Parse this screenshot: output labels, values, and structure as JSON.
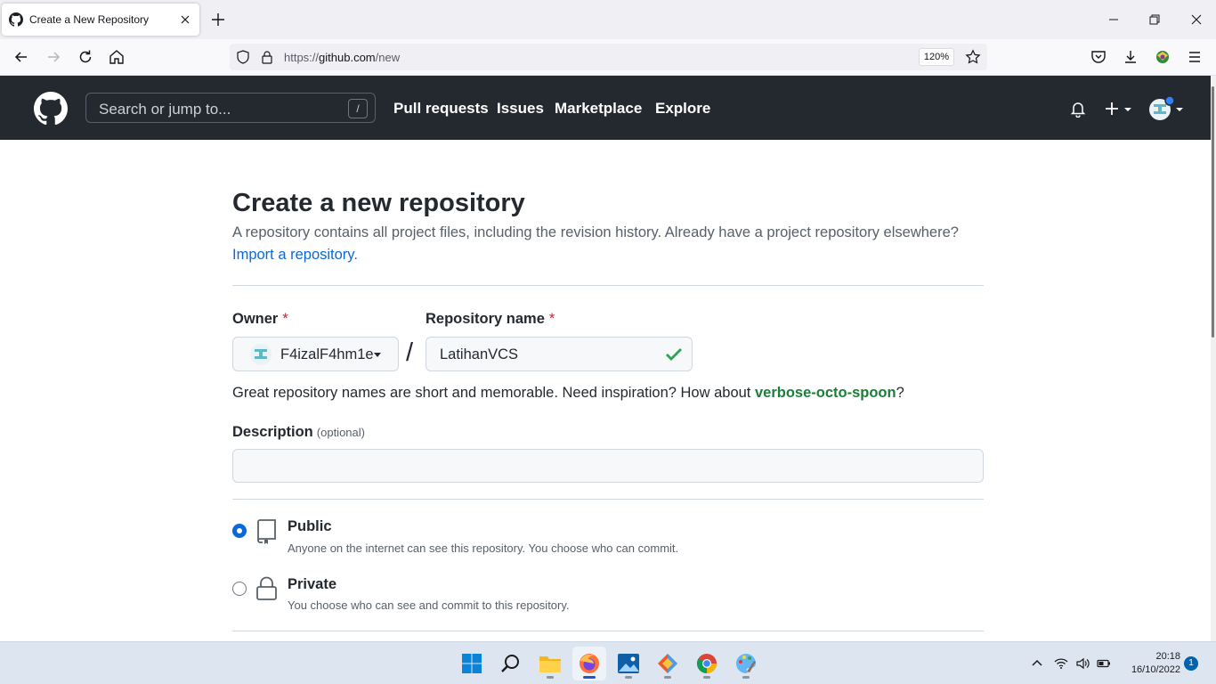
{
  "browser": {
    "tab_title": "Create a New Repository",
    "url_scheme": "https://",
    "url_host": "github.com",
    "url_path": "/new",
    "zoom": "120%"
  },
  "github_header": {
    "search_placeholder": "Search or jump to...",
    "search_shortcut": "/",
    "nav": [
      "Pull requests",
      "Issues",
      "Marketplace",
      "Explore"
    ]
  },
  "page": {
    "title": "Create a new repository",
    "subtitle": "A repository contains all project files, including the revision history. Already have a project repository elsewhere?",
    "import_link": "Import a repository.",
    "owner_label": "Owner",
    "required_mark": "*",
    "owner_value": "F4izalF4hm1e",
    "separator": "/",
    "repo_label": "Repository name",
    "repo_value": "LatihanVCS",
    "suggest_text": "Great repository names are short and memorable. Need inspiration? How about ",
    "suggest_name": "verbose-octo-spoon",
    "suggest_end": "?",
    "description_label": "Description",
    "description_optional": "(optional)",
    "description_value": "",
    "visibility": [
      {
        "title": "Public",
        "desc": "Anyone on the internet can see this repository. You choose who can commit.",
        "selected": true
      },
      {
        "title": "Private",
        "desc": "You choose who can see and commit to this repository.",
        "selected": false
      }
    ]
  },
  "taskbar": {
    "time": "20:18",
    "date": "16/10/2022",
    "notifications": "1"
  },
  "colors": {
    "header_bg": "#24292f",
    "link": "#0969da",
    "success": "#1a7f37",
    "danger": "#cf222e"
  }
}
